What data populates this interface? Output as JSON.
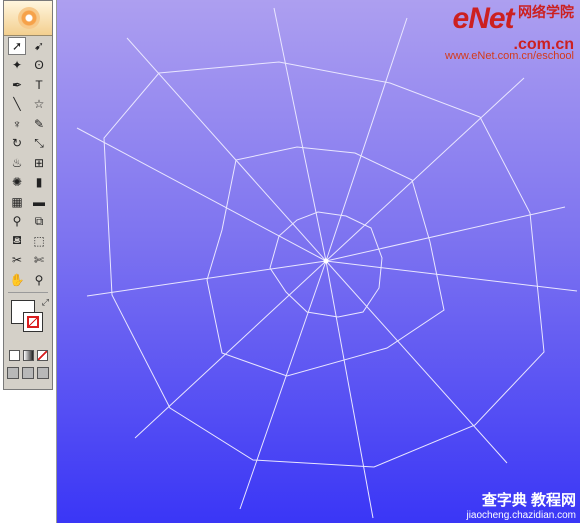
{
  "toolbox": {
    "rows": [
      [
        "selection-tool",
        "direct-selection-tool"
      ],
      [
        "magic-wand-tool",
        "lasso-tool"
      ],
      [
        "pen-tool",
        "type-tool"
      ],
      [
        "line-segment-tool",
        "star-tool"
      ],
      [
        "paintbrush-tool",
        "pencil-tool"
      ],
      [
        "rotate-tool",
        "scale-tool"
      ],
      [
        "warp-tool",
        "free-transform-tool"
      ],
      [
        "symbol-sprayer-tool",
        "column-graph-tool"
      ],
      [
        "mesh-tool",
        "gradient-tool"
      ],
      [
        "eyedropper-tool",
        "blend-tool"
      ],
      [
        "live-paint-bucket-tool",
        "live-paint-selection-tool"
      ],
      [
        "slice-tool",
        "scissors-tool"
      ],
      [
        "hand-tool",
        "zoom-tool"
      ]
    ],
    "glyphs": {
      "selection-tool": "➚",
      "direct-selection-tool": "➹",
      "magic-wand-tool": "✦",
      "lasso-tool": "ʘ",
      "pen-tool": "✒",
      "type-tool": "T",
      "line-segment-tool": "╲",
      "star-tool": "☆",
      "paintbrush-tool": "♆",
      "pencil-tool": "✎",
      "rotate-tool": "↻",
      "scale-tool": "⤡",
      "warp-tool": "♨",
      "free-transform-tool": "⊞",
      "symbol-sprayer-tool": "✺",
      "column-graph-tool": "▮",
      "mesh-tool": "▦",
      "gradient-tool": "▬",
      "eyedropper-tool": "⚲",
      "blend-tool": "⧉",
      "live-paint-bucket-tool": "⛾",
      "live-paint-selection-tool": "⬚",
      "slice-tool": "✂",
      "scissors-tool": "✄",
      "hand-tool": "✋",
      "zoom-tool": "⚲"
    }
  },
  "logo": {
    "brand": "eNet",
    "cn_text": "网络学院",
    "com": ".com.cn",
    "url": "www.eNet.com.cn/eschool"
  },
  "watermark": {
    "title": "查字典 教程网",
    "url": "jiaocheng.chazidian.com"
  },
  "colors": {
    "line": "#e9e6ff",
    "bg_top": "#ad9ff0",
    "bg_bottom": "#3a36f6",
    "logo_red": "#cc2020"
  }
}
